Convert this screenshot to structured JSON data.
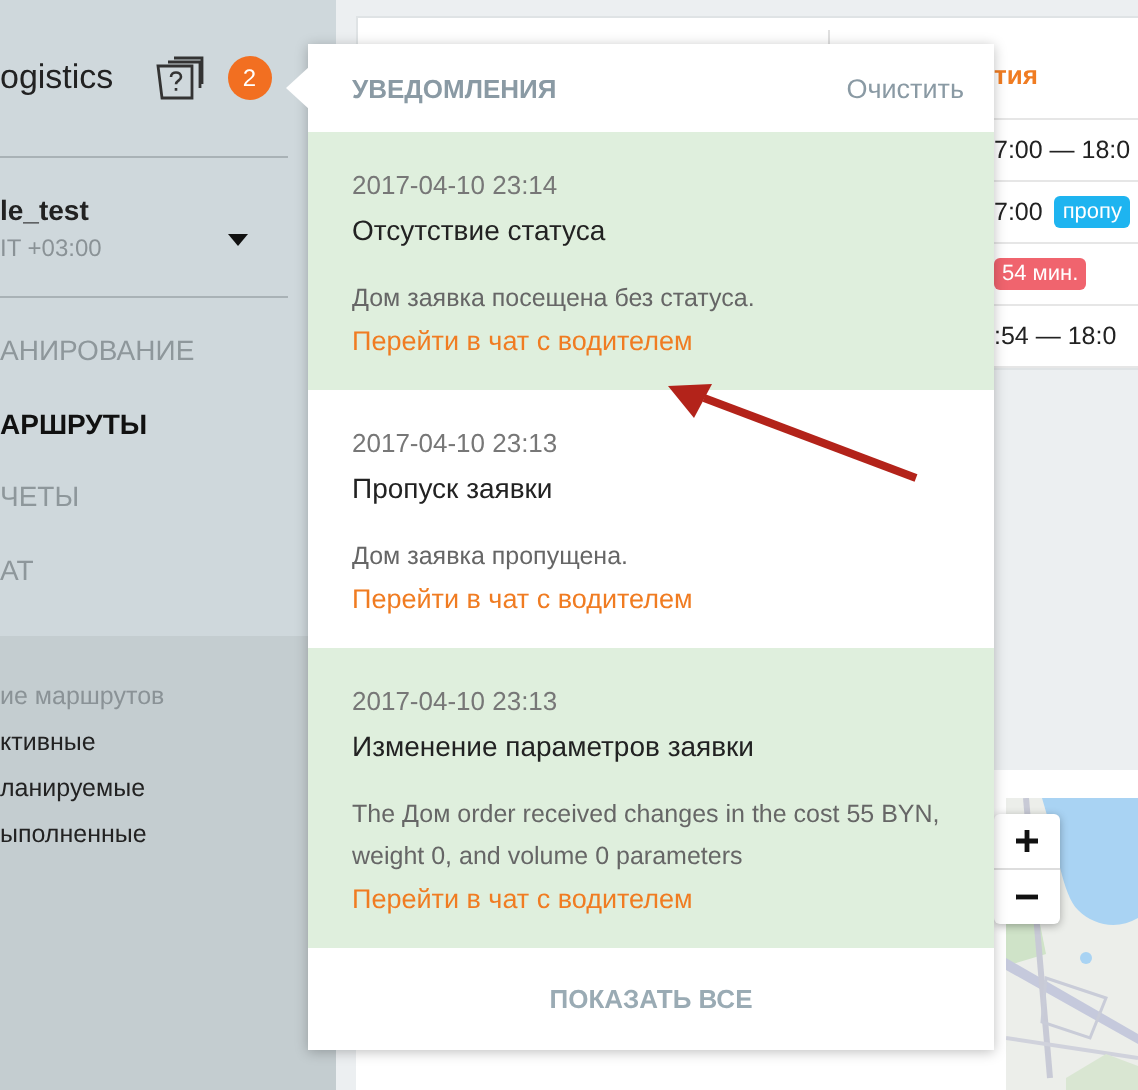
{
  "sidebar": {
    "brand": "ogistics",
    "notification_count": "2",
    "account": {
      "name": "le_test",
      "timezone": "IT +03:00"
    },
    "nav": [
      {
        "label": "АНИРОВАНИЕ",
        "selected": false
      },
      {
        "label": "АРШРУТЫ",
        "selected": true
      },
      {
        "label": "ЧЕТЫ",
        "selected": false
      },
      {
        "label": "АТ",
        "selected": false
      }
    ],
    "filter_heading": "ие маршрутов",
    "filters": [
      "ктивные",
      "ланируемые",
      "ыполненные"
    ]
  },
  "table": {
    "header": "тия",
    "rows": [
      {
        "time": "7:00 — 18:0"
      },
      {
        "time": "7:00",
        "tag": {
          "text": "пропу",
          "color": "#1eb4f0"
        }
      },
      {
        "tag": {
          "text": "54 мин.",
          "color": "#f0646e"
        }
      },
      {
        "time": ":54 — 18:0"
      }
    ]
  },
  "notifications": {
    "title": "УВЕДОМЛЕНИЯ",
    "clear": "Очистить",
    "items": [
      {
        "time": "2017-04-10 23:14",
        "title": "Отсутствие статуса",
        "text": "Дом заявка посещена без статуса.",
        "link": "Перейти в чат с водителем",
        "unread": true
      },
      {
        "time": "2017-04-10 23:13",
        "title": "Пропуск заявки",
        "text": "Дом заявка пропущена.",
        "link": "Перейти в чат с водителем",
        "unread": false
      },
      {
        "time": "2017-04-10 23:13",
        "title": "Изменение параметров заявки",
        "text": "The Дом order received changes in the cost 55 BYN, weight 0, and volume 0 parameters",
        "link": "Перейти в чат с водителем",
        "unread": true
      }
    ],
    "show_all": "ПОКАЗАТЬ ВСЕ"
  }
}
